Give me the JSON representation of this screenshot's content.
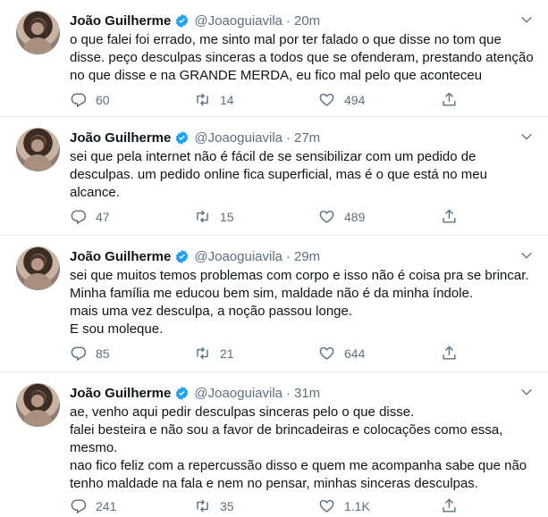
{
  "tweets": [
    {
      "name": "João Guilherme",
      "handle": "@Joaoguiavila",
      "dot": "·",
      "time": "20m",
      "lines": [
        "o que falei foi errado, me sinto mal por ter falado o que disse no tom que",
        "disse. peço desculpas sinceras a todos que se ofenderam, prestando atenção",
        "no que disse e na GRANDE MERDA, eu fico mal pelo que aconteceu"
      ],
      "replies": "60",
      "retweets": "14",
      "likes": "494"
    },
    {
      "name": "João Guilherme",
      "handle": "@Joaoguiavila",
      "dot": "·",
      "time": "27m",
      "lines": [
        "sei que pela internet não é fácil de se sensibilizar com um pedido de",
        "desculpas. um pedido online fica superficial, mas é o que está no meu",
        "alcance."
      ],
      "replies": "47",
      "retweets": "15",
      "likes": "489"
    },
    {
      "name": "João Guilherme",
      "handle": "@Joaoguiavila",
      "dot": "·",
      "time": "29m",
      "lines": [
        "sei que muitos temos problemas com corpo e isso não é coisa pra se brincar.",
        "Minha família me educou bem sim, maldade não é da minha índole.",
        "mais uma vez desculpa, a noção passou longe.",
        "E sou moleque."
      ],
      "replies": "85",
      "retweets": "21",
      "likes": "644"
    },
    {
      "name": "João Guilherme",
      "handle": "@Joaoguiavila",
      "dot": "·",
      "time": "31m",
      "lines": [
        "ae, venho aqui pedir desculpas sinceras pelo o que disse.",
        "falei besteira e não sou a favor de brincadeiras e colocações como essa,",
        "mesmo.",
        "nao fico feliz com a repercussão disso e quem me acompanha sabe que não",
        "tenho maldade na fala e nem no pensar, minhas sinceras desculpas."
      ],
      "replies": "241",
      "retweets": "35",
      "likes": "1.1K"
    }
  ],
  "icons": {
    "verified": "verified-badge-icon",
    "caret": "chevron-down-icon",
    "reply": "reply-icon",
    "retweet": "retweet-icon",
    "like": "like-icon",
    "share": "share-icon"
  },
  "colors": {
    "verified": "#1da1f2",
    "secondary_text": "#5b7083",
    "divider": "#e6ecf0"
  }
}
